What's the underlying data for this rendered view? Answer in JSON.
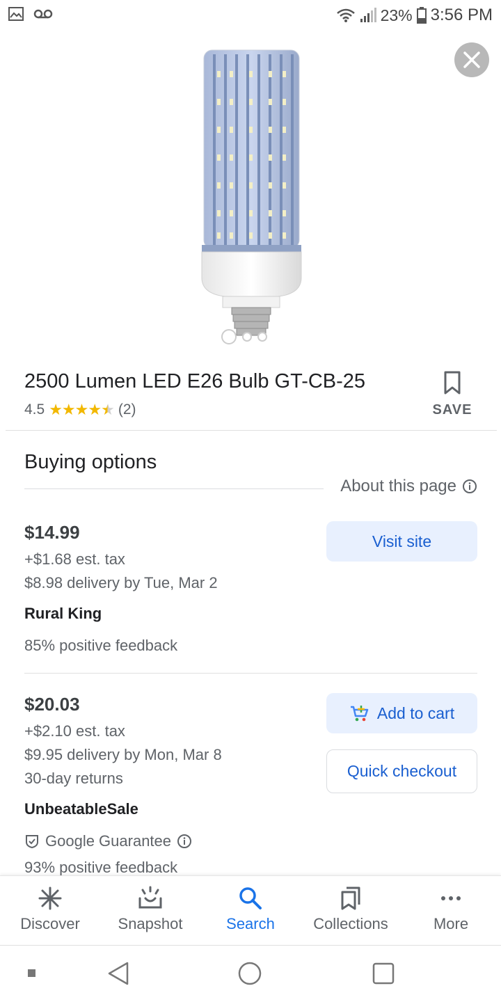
{
  "status_bar": {
    "icons_left": [
      "image-icon",
      "voicemail-icon"
    ],
    "battery": "23%",
    "time": "3:56 PM"
  },
  "product": {
    "title": "2500 Lumen LED E26 Bulb GT-CB-25",
    "rating": "4.5",
    "stars": "★★★★",
    "review_count": "(2)",
    "save_label": "SAVE",
    "image_count": 3,
    "active_image": 1
  },
  "buying": {
    "title": "Buying options",
    "about_label": "About this page"
  },
  "offers": [
    {
      "price": "$14.99",
      "tax": "+$1.68 est. tax",
      "delivery": "$8.98 delivery by Tue, Mar 2",
      "seller": "Rural King",
      "feedback": "85% positive feedback",
      "button": "Visit site"
    },
    {
      "price": "$20.03",
      "tax": "+$2.10 est. tax",
      "delivery": "$9.95 delivery by Mon, Mar 8",
      "returns": "30-day returns",
      "seller": "UnbeatableSale",
      "guarantee": "Google Guarantee",
      "feedback": "93% positive feedback",
      "button_primary": "Add to cart",
      "button_secondary": "Quick checkout"
    }
  ],
  "bottom_nav": [
    {
      "label": "Discover",
      "icon": "asterisk-icon"
    },
    {
      "label": "Snapshot",
      "icon": "snapshot-icon"
    },
    {
      "label": "Search",
      "icon": "search-icon",
      "active": true
    },
    {
      "label": "Collections",
      "icon": "collections-icon"
    },
    {
      "label": "More",
      "icon": "more-icon"
    }
  ],
  "colors": {
    "accent": "#1a73e8",
    "link": "#1a5fd0",
    "button_bg": "#e8f0fe",
    "star": "#f2b800"
  }
}
